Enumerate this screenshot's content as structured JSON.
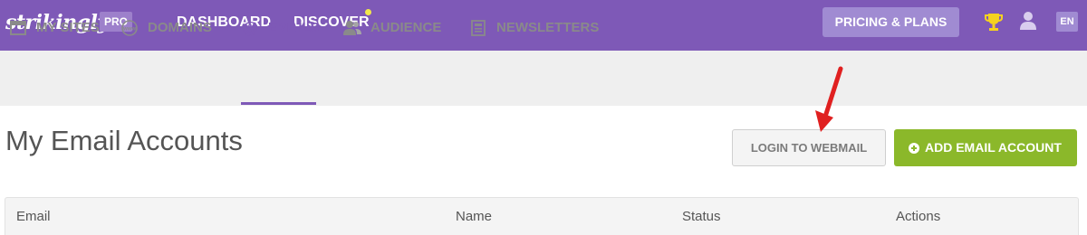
{
  "brand": {
    "logo_text": "strikingly",
    "pro_badge": "PRO"
  },
  "topnav": {
    "dashboard": "DASHBOARD",
    "discover": "DISCOVER",
    "pricing": "PRICING & PLANS",
    "language": "EN"
  },
  "tabs": [
    {
      "label": "MY SITES",
      "icon": "browser-window-icon"
    },
    {
      "label": "DOMAINS",
      "icon": "www-globe-icon"
    },
    {
      "label": "EMAILS",
      "icon": "at-sign-icon",
      "active": true
    },
    {
      "label": "AUDIENCE",
      "icon": "users-icon"
    },
    {
      "label": "NEWSLETTERS",
      "icon": "newsletter-icon"
    }
  ],
  "main": {
    "title": "My Email Accounts",
    "webmail_button": "LOGIN TO WEBMAIL",
    "add_button": "ADD EMAIL ACCOUNT"
  },
  "table": {
    "columns": [
      "Email",
      "Name",
      "Status",
      "Actions"
    ]
  },
  "colors": {
    "brand_purple": "#7e59b7",
    "accent_green": "#8bb82a",
    "annotation_red": "#e02020"
  }
}
